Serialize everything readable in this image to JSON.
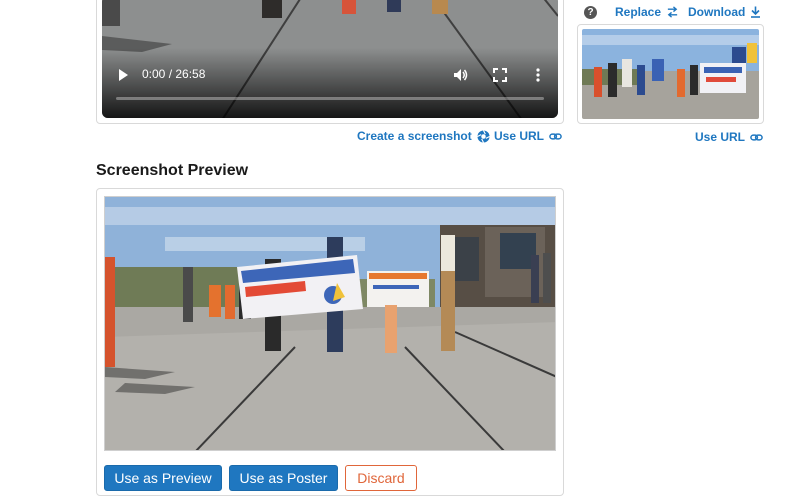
{
  "video": {
    "time": "0:00 / 26:58",
    "progress": 0,
    "links": {
      "create_screenshot": "Create a screenshot",
      "use_url": "Use URL"
    }
  },
  "poster": {
    "help": "?",
    "replace": "Replace",
    "download": "Download",
    "use_url": "Use URL"
  },
  "preview": {
    "title": "Screenshot Preview",
    "buttons": {
      "use_as_preview": "Use as Preview",
      "use_as_poster": "Use as Poster",
      "discard": "Discard"
    }
  },
  "colors": {
    "link": "#1f77c0",
    "primary_button": "#1f77c0",
    "discard": "#e0663a"
  },
  "icons": [
    "play-icon",
    "volume-icon",
    "fullscreen-icon",
    "more-vert-icon",
    "screenshot-icon",
    "link-icon",
    "help-icon",
    "swap-icon",
    "download-icon"
  ]
}
